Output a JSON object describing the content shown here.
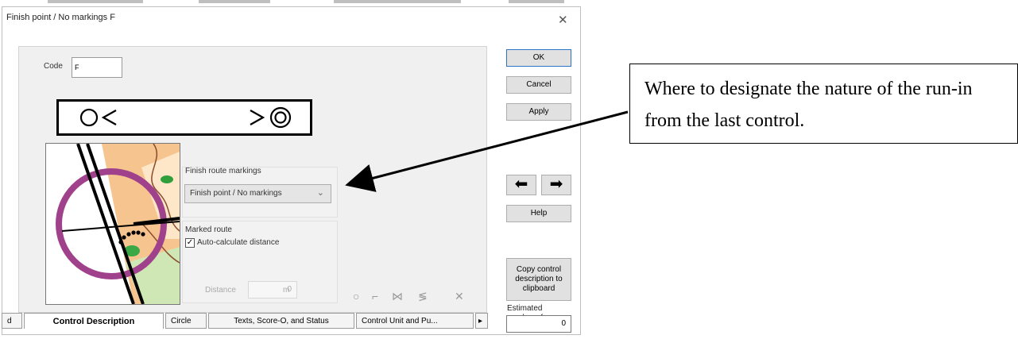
{
  "window": {
    "title": "Finish point / No markings F",
    "close_icon": "close-icon"
  },
  "code": {
    "label": "Code",
    "value": "F"
  },
  "finish_route": {
    "group_label": "Finish route markings",
    "selected": "Finish point / No markings"
  },
  "marked_route": {
    "group_label": "Marked route",
    "auto_calc_label": "Auto-calculate distance",
    "auto_calc_checked": true,
    "distance_label": "Distance",
    "distance_value": "0",
    "distance_unit": "m"
  },
  "side_buttons": {
    "ok": "OK",
    "cancel": "Cancel",
    "apply": "Apply",
    "help": "Help",
    "copy": "Copy control description to clipboard",
    "prev_icon": "arrow-left-icon",
    "next_icon": "arrow-right-icon"
  },
  "estimated": {
    "label": "Estimated number of competitors",
    "value": "0"
  },
  "tabs": [
    {
      "label": "d"
    },
    {
      "label": "Control Description",
      "active": true
    },
    {
      "label": "Circle"
    },
    {
      "label": "Texts, Score-O, and Status"
    },
    {
      "label": "Control Unit and Pu..."
    }
  ],
  "tab_scroll_icon": "scroll-right-icon",
  "callout": {
    "text": "Where to designate the nature of the run-in from the last control."
  },
  "colors": {
    "ok_border": "#2b74c7",
    "map_circle": "#a0418c",
    "map_orange": "#f6c48f"
  }
}
